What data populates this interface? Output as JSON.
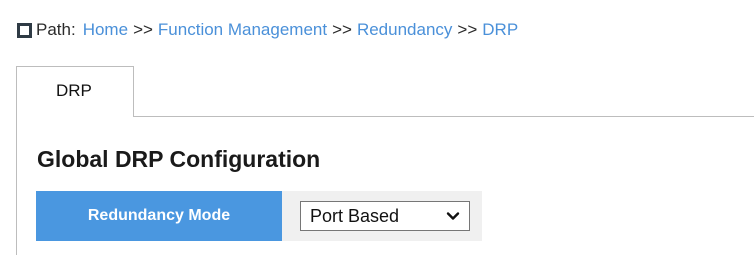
{
  "path": {
    "label": "Path:",
    "separator": ">>",
    "crumbs": [
      "Home",
      "Function Management",
      "Redundancy",
      "DRP"
    ]
  },
  "tabs": [
    {
      "label": "DRP",
      "active": true
    }
  ],
  "section": {
    "title": "Global DRP Configuration"
  },
  "config": {
    "mode_label": "Redundancy Mode",
    "mode_value": "Port Based"
  },
  "icons": {
    "path": "square-icon",
    "dropdown": "chevron-down-icon"
  },
  "colors": {
    "link": "#4a90d9",
    "header_cell": "#4a97e0",
    "value_cell": "#f0f0f0"
  }
}
